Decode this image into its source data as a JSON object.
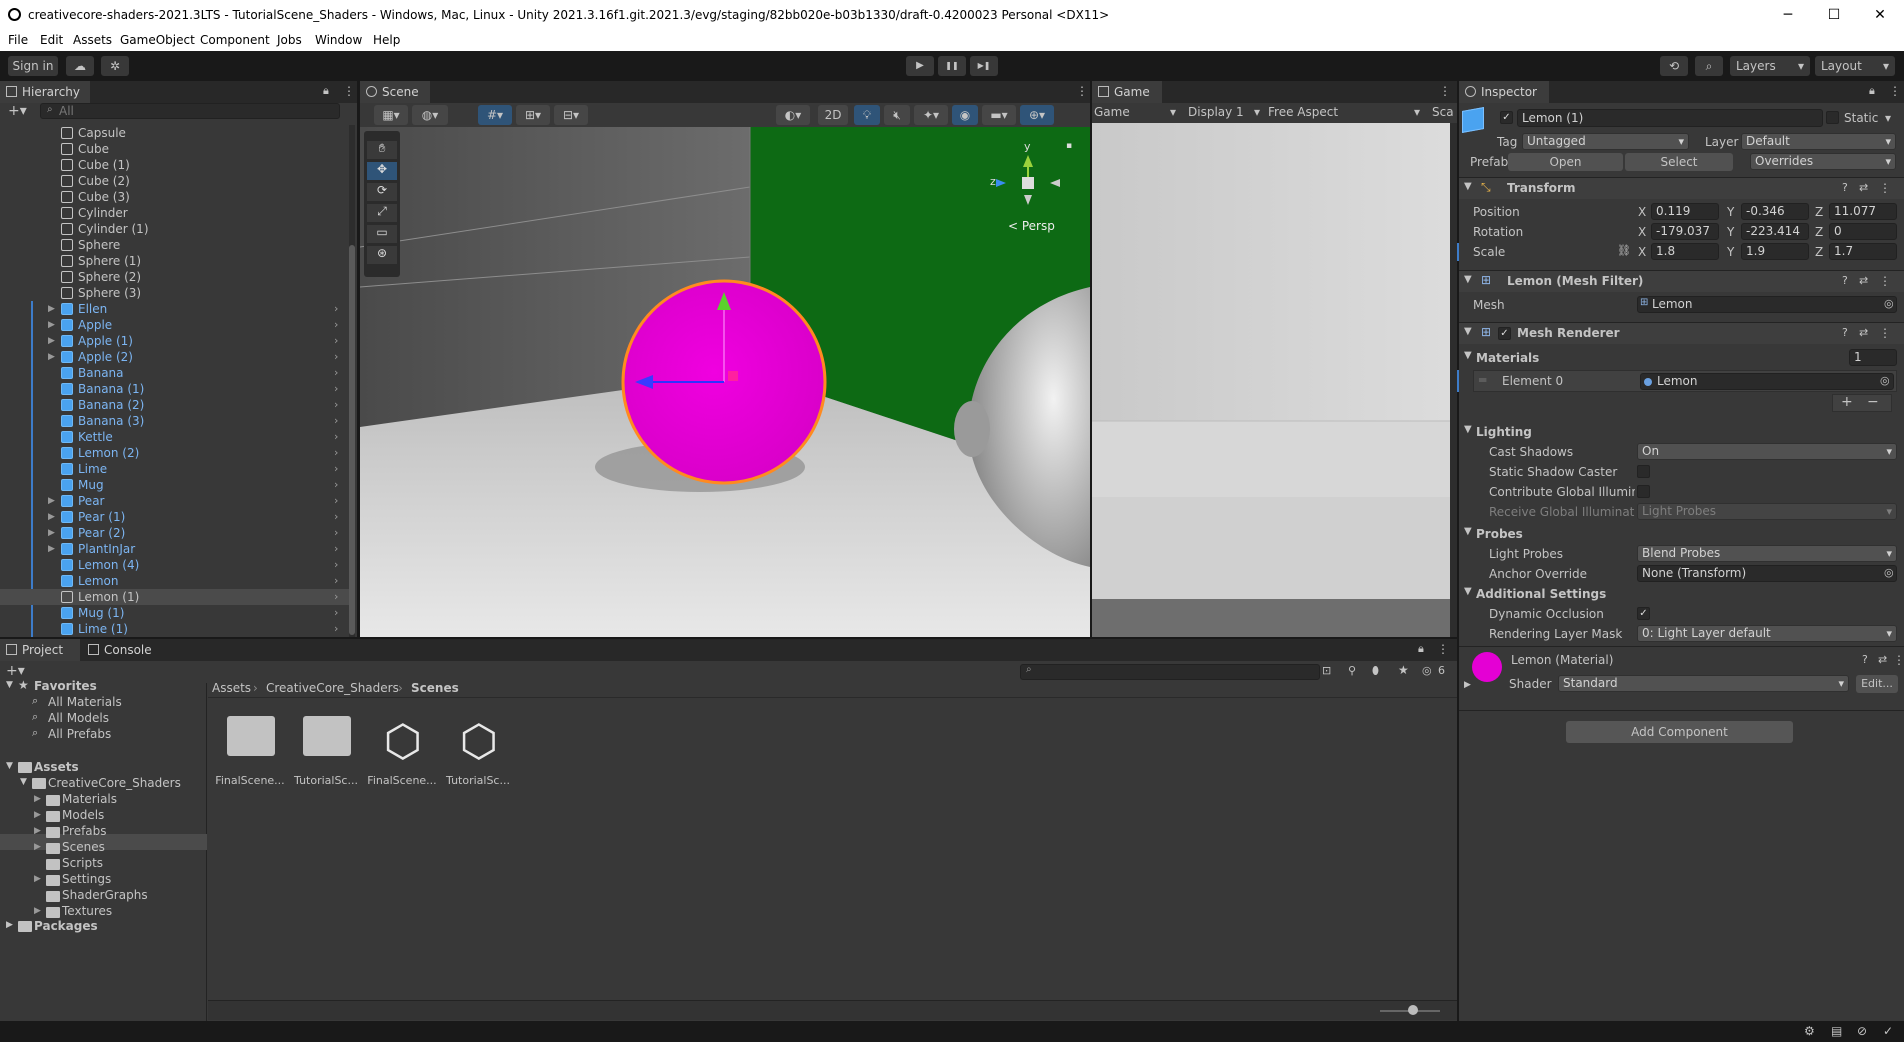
{
  "window": {
    "title": "creativecore-shaders-2021.3LTS - TutorialScene_Shaders - Windows, Mac, Linux - Unity 2021.3.16f1.git.2021.3/evg/staging/82bb020e-b03b1330/draft-0.4200023 Personal <DX11>",
    "minimize": "─",
    "maximize": "☐",
    "close": "✕"
  },
  "menu": [
    "File",
    "Edit",
    "Assets",
    "GameObject",
    "Component",
    "Jobs",
    "Window",
    "Help"
  ],
  "toolbar": {
    "sign_in": "Sign in",
    "play": "▶",
    "pause": "❚❚",
    "step": "▶❚",
    "layers": "Layers",
    "layout": "Layout"
  },
  "hierarchy": {
    "tab": "Hierarchy",
    "search_placeholder": "All",
    "items": [
      {
        "label": "Capsule",
        "prefab": false
      },
      {
        "label": "Cube",
        "prefab": false
      },
      {
        "label": "Cube (1)",
        "prefab": false
      },
      {
        "label": "Cube (2)",
        "prefab": false
      },
      {
        "label": "Cube (3)",
        "prefab": false
      },
      {
        "label": "Cylinder",
        "prefab": false
      },
      {
        "label": "Cylinder (1)",
        "prefab": false
      },
      {
        "label": "Sphere",
        "prefab": false
      },
      {
        "label": "Sphere (1)",
        "prefab": false
      },
      {
        "label": "Sphere (2)",
        "prefab": false
      },
      {
        "label": "Sphere (3)",
        "prefab": false
      },
      {
        "label": "Ellen",
        "prefab": true,
        "expand": true
      },
      {
        "label": "Apple",
        "prefab": true,
        "expand": true
      },
      {
        "label": "Apple (1)",
        "prefab": true,
        "expand": true
      },
      {
        "label": "Apple (2)",
        "prefab": true,
        "expand": true
      },
      {
        "label": "Banana",
        "prefab": true,
        "expand": false
      },
      {
        "label": "Banana (1)",
        "prefab": true,
        "expand": false
      },
      {
        "label": "Banana (2)",
        "prefab": true,
        "expand": false
      },
      {
        "label": "Banana (3)",
        "prefab": true,
        "expand": false
      },
      {
        "label": "Kettle",
        "prefab": true,
        "expand": false
      },
      {
        "label": "Lemon (2)",
        "prefab": true,
        "expand": false
      },
      {
        "label": "Lime",
        "prefab": true,
        "expand": false
      },
      {
        "label": "Mug",
        "prefab": true,
        "expand": false
      },
      {
        "label": "Pear",
        "prefab": true,
        "expand": true
      },
      {
        "label": "Pear (1)",
        "prefab": true,
        "expand": true
      },
      {
        "label": "Pear (2)",
        "prefab": true,
        "expand": true
      },
      {
        "label": "PlantInJar",
        "prefab": true,
        "expand": true
      },
      {
        "label": "Lemon (4)",
        "prefab": true,
        "expand": false
      },
      {
        "label": "Lemon",
        "prefab": true,
        "expand": false
      },
      {
        "label": "Lemon (1)",
        "prefab": false,
        "selected": true
      },
      {
        "label": "Mug (1)",
        "prefab": true,
        "expand": false
      },
      {
        "label": "Lime (1)",
        "prefab": true,
        "expand": false
      }
    ]
  },
  "scene": {
    "tab": "Scene",
    "btn_2d": "2D",
    "gizmo_y": "y",
    "gizmo_z": "z",
    "persp": "< Persp"
  },
  "game": {
    "tab": "Game",
    "mode": "Game",
    "display": "Display 1",
    "aspect": "Free Aspect",
    "scale": "Sca"
  },
  "inspector": {
    "tab": "Inspector",
    "object_name": "Lemon (1)",
    "static": "Static",
    "tag_label": "Tag",
    "tag": "Untagged",
    "layer_label": "Layer",
    "layer": "Default",
    "prefab_label": "Prefab",
    "open": "Open",
    "select": "Select",
    "overrides": "Overrides",
    "transform": {
      "title": "Transform",
      "position_label": "Position",
      "rotation_label": "Rotation",
      "scale_label": "Scale",
      "position": {
        "x": "0.119",
        "y": "-0.346",
        "z": "11.077"
      },
      "rotation": {
        "x": "-179.037",
        "y": "-223.414",
        "z": "0"
      },
      "scale": {
        "x": "1.8",
        "y": "1.9",
        "z": "1.7"
      }
    },
    "mesh_filter": {
      "title": "Lemon (Mesh Filter)",
      "mesh_label": "Mesh",
      "mesh": "Lemon"
    },
    "mesh_renderer": {
      "title": "Mesh Renderer",
      "materials_label": "Materials",
      "materials_count": "1",
      "element0_label": "Element 0",
      "element0": "Lemon",
      "lighting": "Lighting",
      "cast_shadows_label": "Cast Shadows",
      "cast_shadows": "On",
      "static_shadow_label": "Static Shadow Caster",
      "contribute_gi_label": "Contribute Global Illuminat",
      "receive_gi_label": "Receive Global Illuminatio",
      "receive_gi": "Light Probes",
      "probes": "Probes",
      "light_probes_label": "Light Probes",
      "light_probes": "Blend Probes",
      "anchor_label": "Anchor Override",
      "anchor": "None (Transform)",
      "additional": "Additional Settings",
      "dynamic_occ_label": "Dynamic Occlusion",
      "rendering_layer_label": "Rendering Layer Mask",
      "rendering_layer": "0: Light Layer default"
    },
    "material": {
      "title": "Lemon (Material)",
      "shader_label": "Shader",
      "shader": "Standard",
      "edit": "Edit...",
      "color": "#e400d4"
    },
    "add_component": "Add Component"
  },
  "project": {
    "tab_project": "Project",
    "tab_console": "Console",
    "favorites": "Favorites",
    "fav_items": [
      "All Materials",
      "All Models",
      "All Prefabs"
    ],
    "assets": "Assets",
    "creativecore": "CreativeCore_Shaders",
    "folders": [
      "Materials",
      "Models",
      "Prefabs",
      "Scenes",
      "Scripts",
      "Settings",
      "ShaderGraphs",
      "Textures"
    ],
    "packages": "Packages",
    "breadcrumb": [
      "Assets",
      "CreativeCore_Shaders",
      "Scenes"
    ],
    "files": [
      {
        "label": "FinalScene...",
        "kind": "folder"
      },
      {
        "label": "TutorialSc...",
        "kind": "folder"
      },
      {
        "label": "FinalScene...",
        "kind": "unity"
      },
      {
        "label": "TutorialSc...",
        "kind": "unity"
      }
    ],
    "hidden_count": "6"
  },
  "colors": {
    "accent": "#3d7cc9",
    "prefab_text": "#7cb5f2",
    "magenta": "#e400d4",
    "green_wall": "#0d6a14"
  }
}
